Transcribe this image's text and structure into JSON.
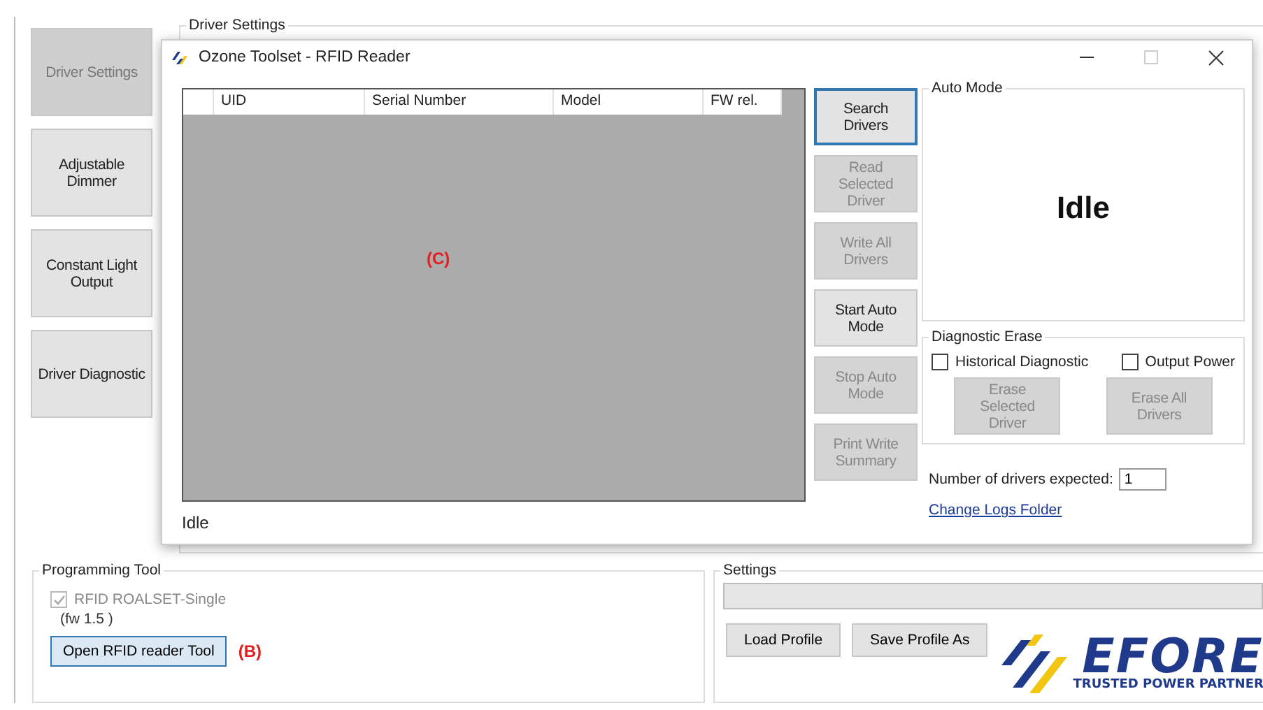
{
  "sidebar": [
    {
      "label": "Driver Settings",
      "selected": true
    },
    {
      "label": "Adjustable Dimmer",
      "selected": false
    },
    {
      "label": "Constant Light Output",
      "selected": false
    },
    {
      "label": "Driver Diagnostic",
      "selected": false
    }
  ],
  "main_group": {
    "title": "Driver Settings"
  },
  "dialog": {
    "title": "Ozone Toolset - RFID Reader",
    "table": {
      "columns": [
        "UID",
        "Serial Number",
        "Model",
        "FW rel."
      ]
    },
    "annotation": "(C)",
    "status": "Idle",
    "actions": [
      {
        "label": "Search Drivers",
        "disabled": false,
        "focused": true
      },
      {
        "label": "Read Selected Driver",
        "disabled": true,
        "focused": false
      },
      {
        "label": "Write All Drivers",
        "disabled": true,
        "focused": false
      },
      {
        "label": "Start Auto Mode",
        "disabled": false,
        "focused": false
      },
      {
        "label": "Stop Auto Mode",
        "disabled": true,
        "focused": false
      },
      {
        "label": "Print Write Summary",
        "disabled": true,
        "focused": false
      }
    ],
    "auto_mode": {
      "title": "Auto Mode",
      "status": "Idle"
    },
    "diagnostic_erase": {
      "title": "Diagnostic Erase",
      "options": [
        {
          "label": "Historical Diagnostic",
          "checked": false
        },
        {
          "label": "Output Power",
          "checked": false
        }
      ],
      "buttons": [
        {
          "label": "Erase Selected Driver",
          "disabled": true
        },
        {
          "label": "Erase All Drivers",
          "disabled": true
        }
      ]
    },
    "drivers_expected": {
      "label": "Number of drivers expected:",
      "value": "1"
    },
    "link": "Change Logs Folder"
  },
  "programming_tool": {
    "title": "Programming Tool",
    "device": {
      "label": "RFID ROALSET-Single",
      "checked": true,
      "disabled": true
    },
    "firmware": "(fw 1.5 )",
    "button": {
      "label": "Open RFID reader Tool",
      "focused": true
    },
    "annotation": "(B)"
  },
  "settings": {
    "title": "Settings",
    "buttons": [
      "Load Profile",
      "Save Profile As"
    ],
    "logo": {
      "name": "EFORE",
      "tagline": "TRUSTED POWER PARTNER"
    }
  }
}
